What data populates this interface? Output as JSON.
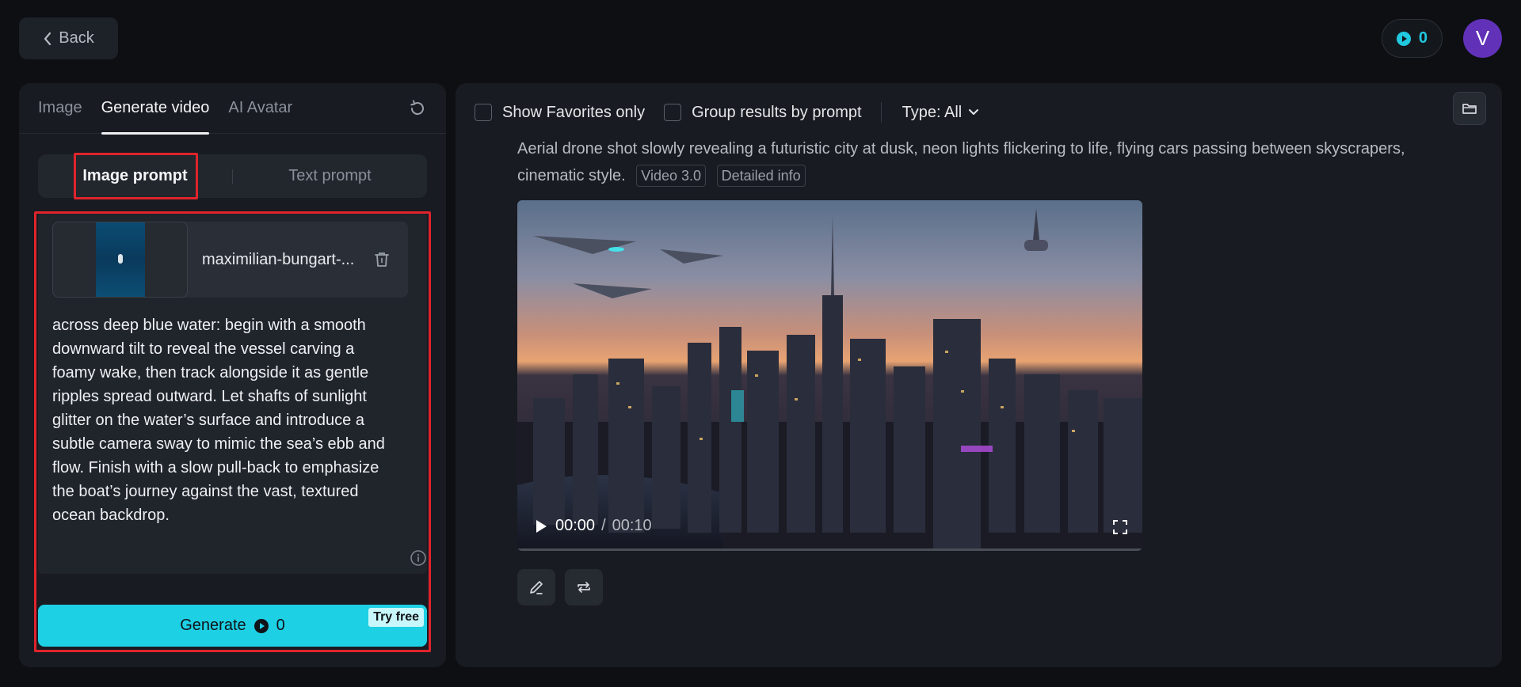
{
  "header": {
    "back_label": "Back",
    "credits": "0",
    "avatar_initial": "V"
  },
  "left": {
    "tabs": [
      {
        "label": "Image"
      },
      {
        "label": "Generate video"
      },
      {
        "label": "AI Avatar"
      }
    ],
    "segment": {
      "image_prompt": "Image prompt",
      "text_prompt": "Text prompt"
    },
    "file": {
      "name": "maximilian-bungart-..."
    },
    "prompt_text": "across deep blue water: begin with a smooth downward tilt to reveal the vessel carving a foamy wake, then track alongside it as gentle ripples spread outward. Let shafts of sunlight glitter on the water’s surface and introduce a subtle camera sway to mimic the sea’s ebb and flow. Finish with a slow pull-back to emphasize the boat’s journey against the vast, textured ocean backdrop.",
    "generate": {
      "label": "Generate",
      "cost": "0",
      "badge": "Try free"
    }
  },
  "right": {
    "toolbar": {
      "favorites_label": "Show Favorites only",
      "group_label": "Group results by prompt",
      "type_label": "Type: All"
    },
    "result": {
      "description": "Aerial drone shot slowly revealing a futuristic city at dusk, neon lights flickering to life, flying cars passing between skyscrapers, cinematic style.",
      "model_badge": "Video 3.0",
      "info_badge": "Detailed info",
      "current_time": "00:00",
      "separator": "/",
      "duration": "00:10"
    }
  },
  "colors": {
    "accent": "#1ed0e4",
    "highlight": "#e0242c",
    "panel": "#181b21",
    "background": "#0d0f13"
  }
}
